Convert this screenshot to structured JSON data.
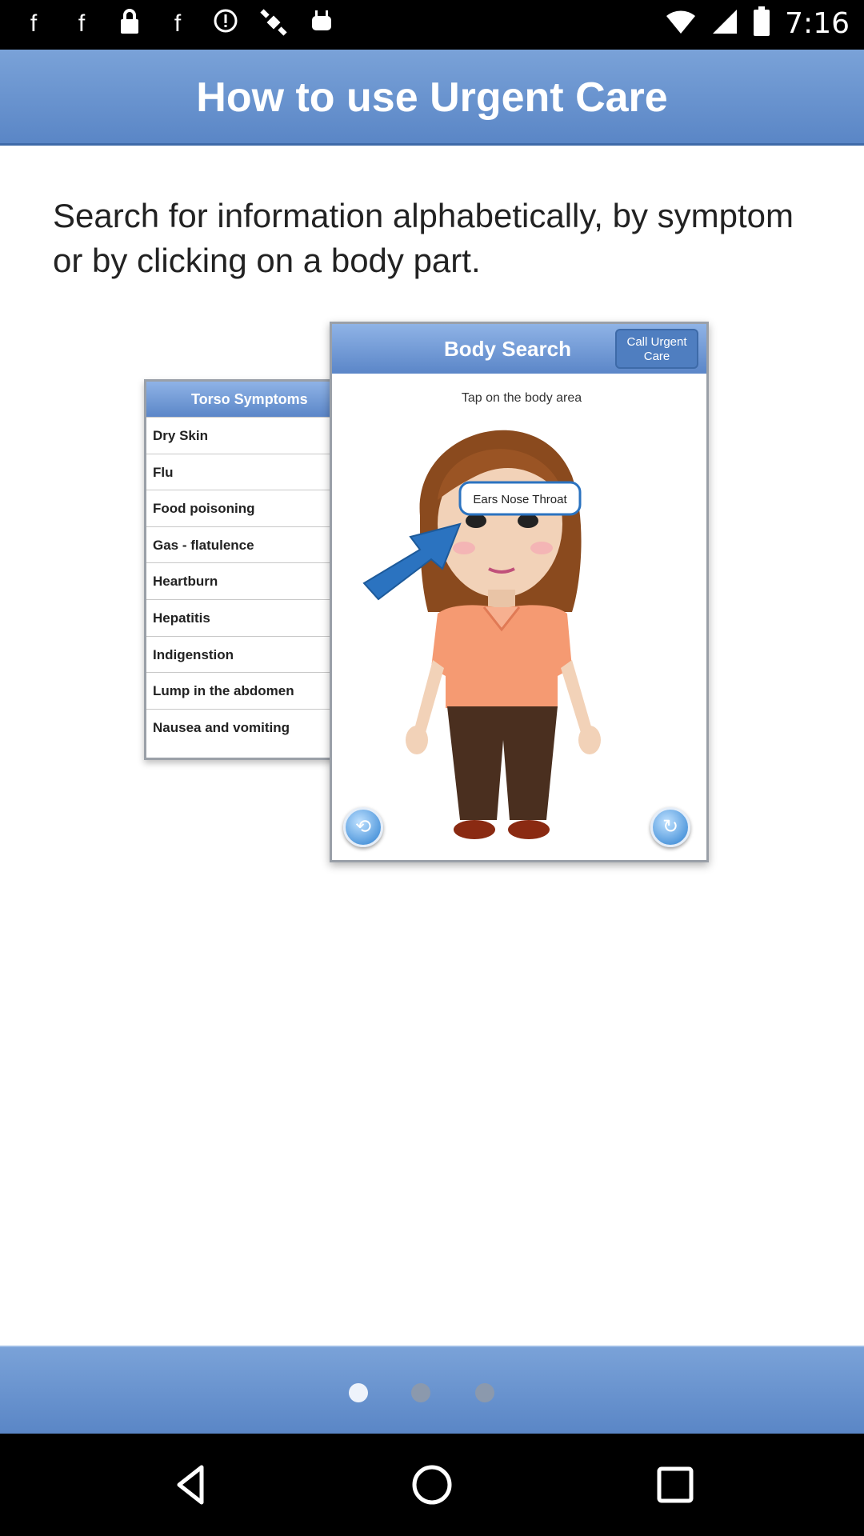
{
  "status_bar": {
    "time": "7:16",
    "left_icons": [
      "facebook-icon",
      "facebook-icon",
      "lock-icon",
      "facebook-icon",
      "alert-icon",
      "satellite-icon",
      "android-icon"
    ],
    "right_icons": [
      "wifi-icon",
      "signal-icon",
      "battery-icon"
    ]
  },
  "header": {
    "title": "How to use Urgent Care"
  },
  "description": "Search for information alphabetically, by symptom or by clicking on a body part.",
  "illustration": {
    "list": {
      "title": "Torso Symptoms",
      "items": [
        "Dry Skin",
        "Flu",
        "Food poisoning",
        "Gas - flatulence",
        "Heartburn",
        "Hepatitis",
        "Indigenstion",
        "Lump in the abdomen",
        "Nausea and vomiting"
      ]
    },
    "body": {
      "title": "Body Search",
      "call_button": "Call Urgent Care",
      "instruction": "Tap on the body area",
      "callout": "Ears Nose Throat"
    }
  },
  "pager": {
    "pages": 3,
    "current": 1
  },
  "nav": {
    "back": "back-icon",
    "home": "home-icon",
    "recents": "recents-icon"
  },
  "colors": {
    "accent": "#5a86c6",
    "callout": "#2b73c0"
  }
}
